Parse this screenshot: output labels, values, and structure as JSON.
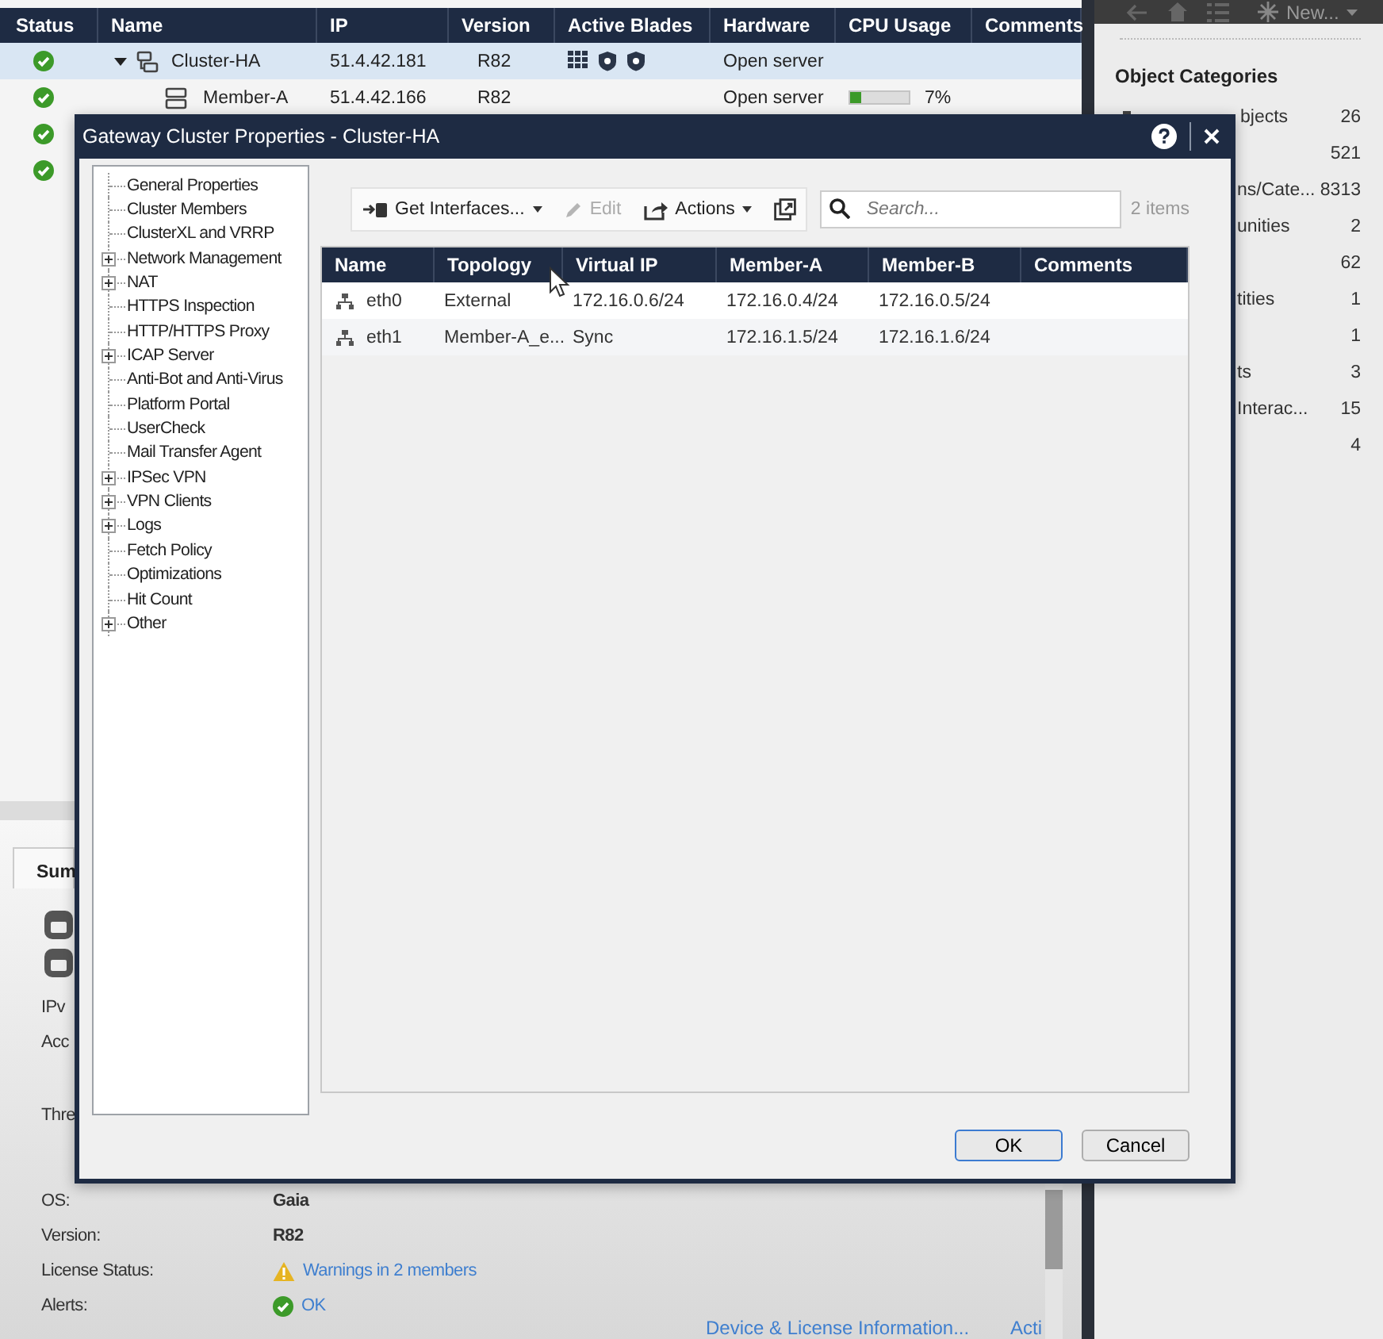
{
  "main_table": {
    "columns": [
      "Status",
      "Name",
      "IP",
      "Version",
      "Active Blades",
      "Hardware",
      "CPU Usage",
      "Comments"
    ],
    "rows": [
      {
        "kind": "cluster",
        "expanded": true,
        "selected": true,
        "name": "Cluster-HA",
        "ip": "51.4.42.181",
        "version": "R82",
        "blades": [
          {
            "kind": "grid"
          },
          {
            "kind": "shield"
          },
          {
            "kind": "shield"
          }
        ],
        "hardware": "Open server"
      },
      {
        "kind": "member",
        "selected": false,
        "name": "Member-A",
        "ip": "51.4.42.166",
        "version": "R82",
        "hardware": "Open server",
        "cpu": {
          "level": 0.2,
          "reading": "7%"
        }
      },
      {
        "kind": "hidden",
        "selected": false
      },
      {
        "kind": "hidden",
        "selected": false
      }
    ]
  },
  "summary": {
    "tab": "Sum",
    "fields": [
      {
        "label": "IPv"
      },
      {
        "label": "Acc"
      },
      {
        "label": "Thre"
      },
      {
        "label": "OS:",
        "value": "Gaia",
        "kind": "text"
      },
      {
        "label": "Version:",
        "value": "R82",
        "kind": "bold"
      },
      {
        "label": "License Status:",
        "value": "Warnings in 2 members",
        "kind": "warning"
      },
      {
        "label": "Alerts:",
        "value": "OK",
        "kind": "ok"
      }
    ],
    "links": [
      "Device & License Information...",
      "Acti"
    ]
  },
  "toolbar": {
    "new_button": "New..."
  },
  "object_categories": {
    "title": "Object Categories",
    "items": [
      {
        "kind": "pinned",
        "label": "bjects",
        "count": "26"
      },
      {
        "kind": "partial",
        "count": "521"
      },
      {
        "kind": "partial",
        "label": "ns/Cate...",
        "count": "8313"
      },
      {
        "kind": "partial",
        "label": "unities",
        "count": "2"
      },
      {
        "kind": "partial",
        "count": "62"
      },
      {
        "kind": "partial",
        "label": "tities",
        "count": "1"
      },
      {
        "kind": "partial",
        "count": "1"
      },
      {
        "kind": "partial",
        "label": "ts",
        "count": "3"
      },
      {
        "kind": "partial",
        "label": "Interac...",
        "count": "15"
      },
      {
        "kind": "partial",
        "count": "4"
      }
    ]
  },
  "dialog": {
    "title": "Gateway Cluster Properties - Cluster-HA",
    "tree": [
      {
        "label": "General Properties",
        "kind": "leaf"
      },
      {
        "label": "Cluster Members",
        "kind": "leaf"
      },
      {
        "label": "ClusterXL and VRRP",
        "kind": "leaf"
      },
      {
        "label": "Network Management",
        "kind": "group"
      },
      {
        "label": "NAT",
        "kind": "group"
      },
      {
        "label": "HTTPS Inspection",
        "kind": "leaf"
      },
      {
        "label": "HTTP/HTTPS Proxy",
        "kind": "leaf"
      },
      {
        "label": "ICAP Server",
        "kind": "group"
      },
      {
        "label": "Anti-Bot and Anti-Virus",
        "kind": "leaf"
      },
      {
        "label": "Platform Portal",
        "kind": "leaf"
      },
      {
        "label": "UserCheck",
        "kind": "leaf"
      },
      {
        "label": "Mail Transfer Agent",
        "kind": "leaf"
      },
      {
        "label": "IPSec VPN",
        "kind": "group"
      },
      {
        "label": "VPN Clients",
        "kind": "group"
      },
      {
        "label": "Logs",
        "kind": "group"
      },
      {
        "label": "Fetch Policy",
        "kind": "leaf"
      },
      {
        "label": "Optimizations",
        "kind": "leaf"
      },
      {
        "label": "Hit Count",
        "kind": "leaf"
      },
      {
        "label": "Other",
        "kind": "group"
      }
    ],
    "toolbar": [
      {
        "label": "Get Interfaces...",
        "kind": "dropdown",
        "disabled": false
      },
      {
        "label": "Edit",
        "kind": "plain",
        "disabled": true
      },
      {
        "label": "Actions",
        "kind": "dropdown",
        "disabled": false
      }
    ],
    "search": {
      "placeholder": "Search..."
    },
    "item_count": "2 items",
    "table": {
      "columns": [
        "Name",
        "Topology",
        "Virtual IP",
        "Member-A",
        "Member-B",
        "Comments"
      ],
      "rows": [
        [
          "eth0",
          "External",
          "172.16.0.6/24",
          "172.16.0.4/24",
          "172.16.0.5/24"
        ],
        [
          "eth1",
          "Member-A_e...",
          "Sync",
          "172.16.1.5/24",
          "172.16.1.6/24"
        ]
      ]
    },
    "buttons": [
      {
        "label": "OK",
        "kind": "default"
      },
      {
        "label": "Cancel",
        "kind": "normal"
      }
    ]
  }
}
